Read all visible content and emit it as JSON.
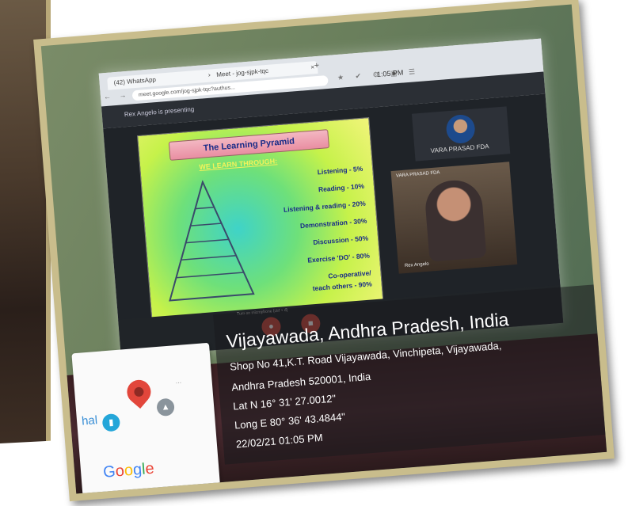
{
  "colors": {
    "frame": "#c9bd8c",
    "overlay": "#19191e",
    "pin": "#e2463b",
    "slide_title_text": "#1a2c88"
  },
  "browser": {
    "tab1_label": "(42) WhatsApp",
    "tab2_label": "Meet - jog-sjpk-tqc",
    "tab_close": "×",
    "new_tab": "+",
    "url": "meet.google.com/jog-sjpk-tqc?authus...",
    "nav_icons": "← → C",
    "ext_icons": "★ ✔ ⚙ ▣ ☰",
    "clock": "1:05 PM"
  },
  "meet": {
    "presenting": "Rex Angelo is presenting",
    "tile1_name": "VARA PRASAD FDA",
    "tile2_name": "VARA PRASAD FDA",
    "tile2_label": "Rex Angelo",
    "present_label": "Turn on microphone (ctrl + d)"
  },
  "slide": {
    "title": "The Learning Pyramid",
    "subtitle": "WE LEARN THROUGH:",
    "items": [
      "Listening - 5%",
      "Reading - 10%",
      "Listening & reading - 20%",
      "Demonstration - 30%",
      "Discussion - 50%",
      "Exercise 'DO' - 80%",
      "Co-operative/",
      "teach others - 90%"
    ]
  },
  "geotag": {
    "map_text": "hal",
    "dots": "...",
    "logo": [
      "G",
      "o",
      "o",
      "g",
      "l",
      "e"
    ],
    "place": "Vijayawada, Andhra Pradesh, India",
    "address_line1": "Shop No 41,K.T. Road Vijayawada, Vinchipeta, Vijayawada,",
    "address_line2": "Andhra Pradesh 520001, India",
    "lat": "Lat N 16° 31' 27.0012\"",
    "long": "Long E 80° 36' 43.4844\"",
    "timestamp": "22/02/21 01:05 PM"
  }
}
